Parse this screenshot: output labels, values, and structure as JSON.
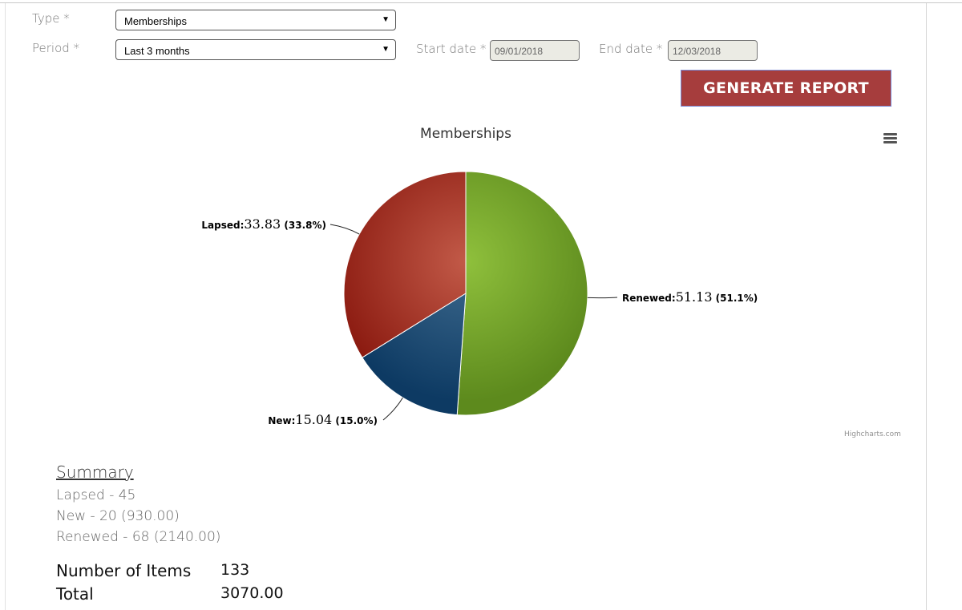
{
  "form": {
    "type_label": "Type *",
    "type_value": "Memberships",
    "period_label": "Period *",
    "period_value": "Last 3 months",
    "start_label": "Start date *",
    "start_value": "09/01/2018",
    "end_label": "End date *",
    "end_value": "12/03/2018",
    "generate_label": "GENERATE REPORT",
    "dropdown_icon": "triangle-down"
  },
  "chart_data": {
    "type": "pie",
    "title": "Memberships",
    "credits": "Highcharts.com",
    "menu_icon": "hamburger-menu",
    "start_angle": "top, clockwise",
    "slices": [
      {
        "name": "Renewed",
        "value": 51.13,
        "percent": "51.1%",
        "color": "#5d8a1d",
        "highlight": "#8fc03c"
      },
      {
        "name": "New",
        "value": 15.04,
        "percent": "15.0%",
        "color": "#0d3a63",
        "highlight": "#3e6a8e"
      },
      {
        "name": "Lapsed",
        "value": 33.83,
        "percent": "33.8%",
        "color": "#8b1a10",
        "highlight": "#c25a48"
      }
    ]
  },
  "summary": {
    "title": "Summary",
    "lines": [
      "Lapsed - 45",
      "New - 20 (930.00)",
      "Renewed - 68 (2140.00)"
    ],
    "items_label": "Number of Items",
    "items_value": "133",
    "total_label": "Total",
    "total_value": "3070.00"
  }
}
